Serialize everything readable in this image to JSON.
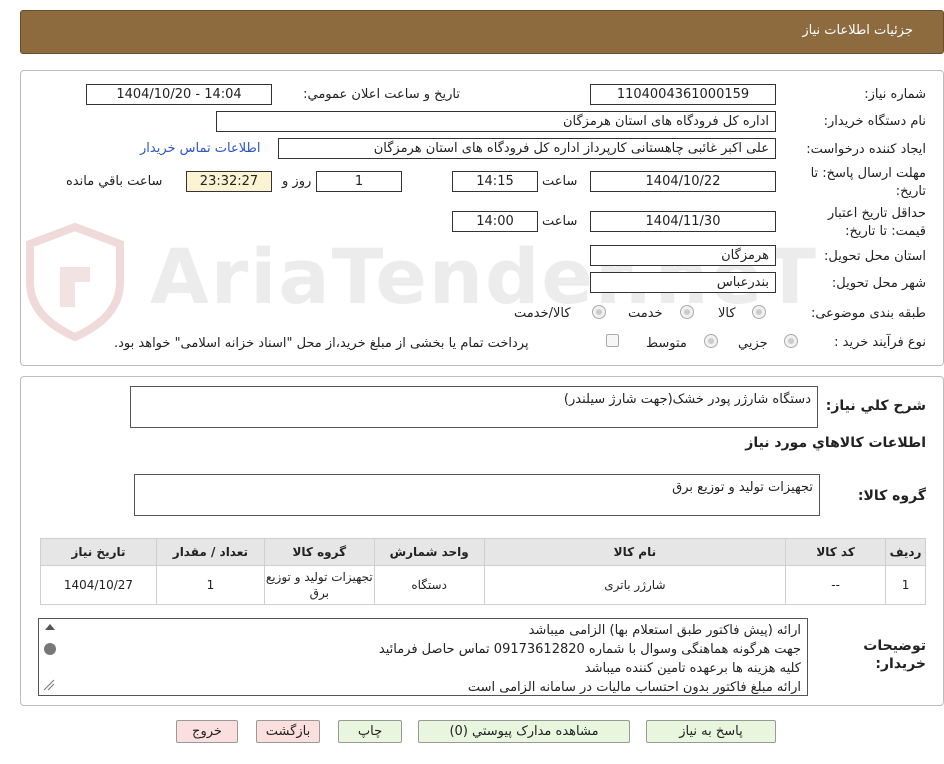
{
  "header": {
    "title": "جزئيات اطلاعات نياز"
  },
  "watermark": "AriaTender.neT",
  "form": {
    "need_number_label": "شماره نياز:",
    "need_number": "1104004361000159",
    "announce_label": "تاريخ و ساعت اعلان عمومي:",
    "announce_value": "1404/10/20 - 14:04",
    "buyer_org_label": "نام دستگاه خريدار:",
    "buyer_org": "اداره کل فرودگاه های استان هرمزگان",
    "creator_label": "ايجاد کننده درخواست:",
    "creator": "علی اکبر غائبی چاهستانی کارپرداز اداره کل فرودگاه های استان هرمزگان",
    "contact_link": "اطلاعات تماس خريدار",
    "deadline_label_1": "مهلت ارسال پاسخ: تا",
    "deadline_label_2": "تاريخ:",
    "deadline_date": "1404/10/22",
    "time_label": "ساعت",
    "deadline_time": "14:15",
    "days": "1",
    "days_label": "روز و",
    "remaining": "23:32:27",
    "remaining_label": "ساعت باقي مانده",
    "validity_label_1": "حداقل تاريخ اعتبار",
    "validity_label_2": "قيمت: تا تاريخ:",
    "validity_date": "1404/11/30",
    "validity_time": "14:00",
    "province_label": "استان محل تحويل:",
    "province": "هرمزگان",
    "city_label": "شهر محل تحويل:",
    "city": "بندرعباس",
    "category_label": "طبقه بندی موضوعی:",
    "category_options": [
      "کالا",
      "خدمت",
      "کالا/خدمت"
    ],
    "process_label": "نوع فرآيند خريد :",
    "process_options": [
      "جزيي",
      "متوسط"
    ],
    "process_note": "پرداخت تمام يا بخشی از مبلغ خريد،از محل \"اسناد خزانه اسلامی\" خواهد بود."
  },
  "summary": {
    "desc_label": "شرح کلي نياز:",
    "desc": "دستگاه شارژر پودر خشک(جهت شارژ سیلندر)",
    "items_title": "اطلاعات کالاهاي مورد نياز",
    "group_label": "گروه کالا:",
    "group": "تجهیزات تولید و توزیع برق"
  },
  "table": {
    "headers": [
      "رديف",
      "کد کالا",
      "نام کالا",
      "واحد شمارش",
      "گروه کالا",
      "تعداد / مقدار",
      "تاريخ نياز"
    ],
    "rows": [
      [
        "1",
        "--",
        "شارژر باتری",
        "دستگاه",
        "تجهیزات تولید و توزیع برق",
        "1",
        "1404/10/27"
      ]
    ]
  },
  "buyer_notes": {
    "label_1": "توضيحات",
    "label_2": "خريدار:",
    "lines": [
      "ارائه (پیش فاکتور طبق استعلام بها)  الزامی میباشد",
      "جهت هرگونه هماهنگی وسوال با شماره 09173612820 تماس حاصل فرمائید",
      "کلیه هزینه ها برعهده تامین کننده میباشد",
      "ارائه مبلغ فاکتور بدون احتساب مالیات در سامانه الزامی است"
    ]
  },
  "buttons": {
    "reply": "پاسخ به نياز",
    "docs": "مشاهده مدارک پيوستي (0)",
    "print": "چاپ",
    "back": "بازگشت",
    "exit": "خروج"
  }
}
